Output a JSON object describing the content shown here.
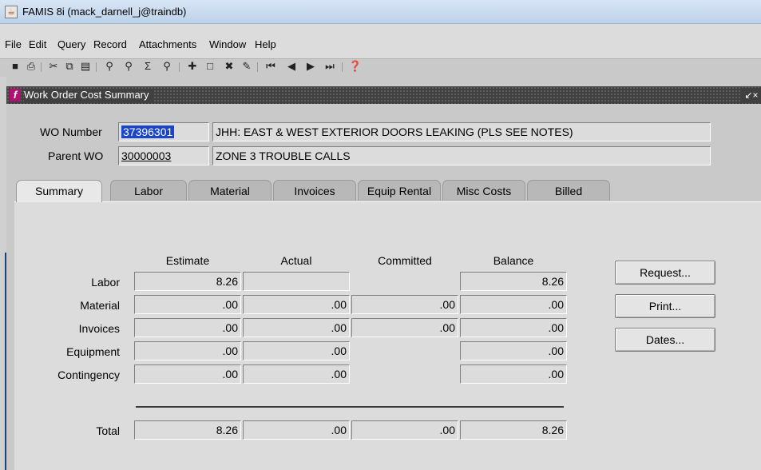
{
  "window": {
    "title": "FAMIS 8i (mack_darnell_j@traindb)"
  },
  "menu": {
    "file": "File",
    "edit": "Edit",
    "query": "Query",
    "record": "Record",
    "attachments": "Attachments",
    "window": "Window",
    "help": "Help"
  },
  "form": {
    "title": "Work Order Cost Summary",
    "wo_number_label": "WO Number",
    "wo_number_value": "37396301",
    "wo_description": "JHH: EAST & WEST EXTERIOR DOORS LEAKING (PLS SEE NOTES)",
    "parent_wo_label": "Parent WO",
    "parent_wo_value": "30000003",
    "parent_description": "ZONE 3 TROUBLE CALLS"
  },
  "tabs": [
    "Summary",
    "Labor",
    "Material",
    "Invoices",
    "Equip Rental",
    "Misc Costs",
    "Billed"
  ],
  "summary": {
    "columns": [
      "Estimate",
      "Actual",
      "Committed",
      "Balance"
    ],
    "rows": [
      {
        "label": "Labor",
        "estimate": "8.26",
        "actual": "",
        "committed": null,
        "balance": "8.26"
      },
      {
        "label": "Material",
        "estimate": ".00",
        "actual": ".00",
        "committed": ".00",
        "balance": ".00"
      },
      {
        "label": "Invoices",
        "estimate": ".00",
        "actual": ".00",
        "committed": ".00",
        "balance": ".00"
      },
      {
        "label": "Equipment",
        "estimate": ".00",
        "actual": ".00",
        "committed": null,
        "balance": ".00"
      },
      {
        "label": "Contingency",
        "estimate": ".00",
        "actual": ".00",
        "committed": null,
        "balance": ".00"
      }
    ],
    "total": {
      "label": "Total",
      "estimate": "8.26",
      "actual": ".00",
      "committed": ".00",
      "balance": "8.26"
    }
  },
  "buttons": {
    "request": "Request...",
    "print": "Print...",
    "dates": "Dates..."
  }
}
